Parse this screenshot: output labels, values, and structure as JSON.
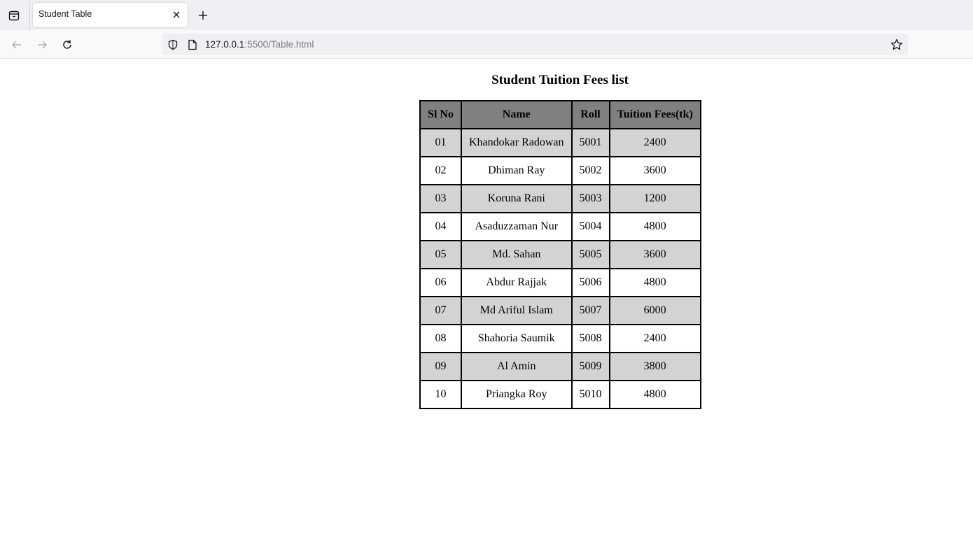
{
  "browser": {
    "tab_title": "Student Table",
    "url_host": "127.0.0.1",
    "url_rest": ":5500/Table.html"
  },
  "page": {
    "title": "Student Tuition Fees list"
  },
  "table": {
    "headers": [
      "Sl No",
      "Name",
      "Roll",
      "Tuition Fees(tk)"
    ],
    "rows": [
      [
        "01",
        "Khandokar Radowan",
        "5001",
        "2400"
      ],
      [
        "02",
        "Dhiman Ray",
        "5002",
        "3600"
      ],
      [
        "03",
        "Koruna Rani",
        "5003",
        "1200"
      ],
      [
        "04",
        "Asaduzzaman Nur",
        "5004",
        "4800"
      ],
      [
        "05",
        "Md. Sahan",
        "5005",
        "3600"
      ],
      [
        "06",
        "Abdur Rajjak",
        "5006",
        "4800"
      ],
      [
        "07",
        "Md Ariful Islam",
        "5007",
        "6000"
      ],
      [
        "08",
        "Shahoria Saumik",
        "5008",
        "2400"
      ],
      [
        "09",
        "Al Amin",
        "5009",
        "3800"
      ],
      [
        "10",
        "Priangka Roy",
        "5010",
        "4800"
      ]
    ]
  },
  "colors": {
    "header_bg": "#808080",
    "odd_row_bg": "#d3d3d3",
    "even_row_bg": "#ffffff"
  }
}
